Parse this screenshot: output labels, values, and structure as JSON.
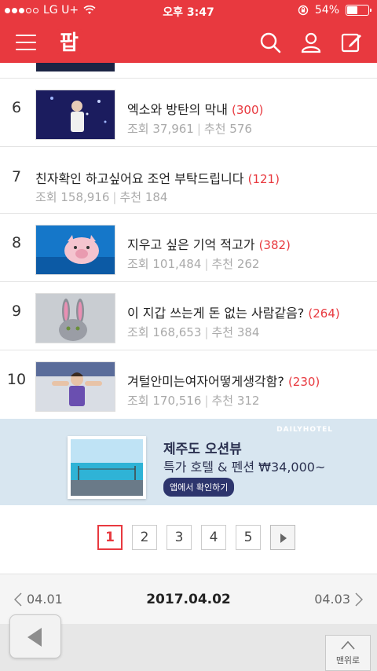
{
  "status_bar": {
    "carrier": "LG U+",
    "time": "오후 3:47",
    "battery": "54%",
    "battery_level": 0.54
  },
  "app": {
    "logo_text": "팝"
  },
  "list": [
    {
      "rank": "6",
      "title": "엑소와 방탄의 막내",
      "comments": "(300)",
      "views": "조회 37,961",
      "recommends": "추천 576",
      "has_thumb": true
    },
    {
      "rank": "7",
      "title": "친자확인 하고싶어요 조언 부탁드립니다",
      "comments": "(121)",
      "views": "조회 158,916",
      "recommends": "추천 184",
      "has_thumb": false
    },
    {
      "rank": "8",
      "title": "지우고 싶은 기억 적고가",
      "comments": "(382)",
      "views": "조회 101,484",
      "recommends": "추천 262",
      "has_thumb": true
    },
    {
      "rank": "9",
      "title": "이 지갑 쓰는게 돈 없는 사람같음?",
      "comments": "(264)",
      "views": "조회 168,653",
      "recommends": "추천 384",
      "has_thumb": true
    },
    {
      "rank": "10",
      "title": "겨털안미는여자어떻게생각함?",
      "comments": "(230)",
      "views": "조회 170,516",
      "recommends": "추천 312",
      "has_thumb": true
    }
  ],
  "banner": {
    "brand": "DAILYHOTEL",
    "headline": "제주도 오션뷰",
    "subline": "특가 호텔 & 펜션 ₩34,000~",
    "cta": "앱에서 확인하기"
  },
  "pagination": {
    "pages": [
      "1",
      "2",
      "3",
      "4",
      "5"
    ],
    "current": "1"
  },
  "date_nav": {
    "prev": "04.01",
    "current": "2017.04.02",
    "next": "04.03"
  },
  "bottom": {
    "top_label": "맨위로"
  },
  "colors": {
    "accent": "#e8393f",
    "meta": "#aaaaaa",
    "banner_bg": "#d8e6f0"
  }
}
